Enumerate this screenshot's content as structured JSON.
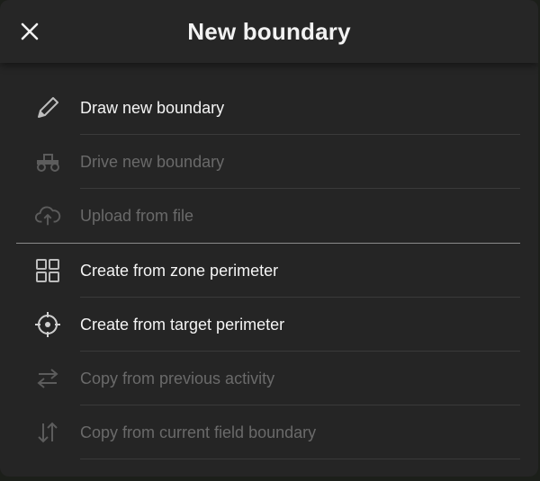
{
  "dialog": {
    "title": "New boundary",
    "close_icon": "close-icon"
  },
  "menu": {
    "group1": [
      {
        "label": "Draw new boundary",
        "icon": "pencil-icon",
        "enabled": true
      },
      {
        "label": "Drive new boundary",
        "icon": "tractor-icon",
        "enabled": false
      },
      {
        "label": "Upload from file",
        "icon": "cloud-upload-icon",
        "enabled": false
      }
    ],
    "group2": [
      {
        "label": "Create from zone perimeter",
        "icon": "grid-icon",
        "enabled": true
      },
      {
        "label": "Create from target perimeter",
        "icon": "crosshair-icon",
        "enabled": true
      },
      {
        "label": "Copy from previous activity",
        "icon": "swap-horizontal-icon",
        "enabled": false
      },
      {
        "label": "Copy from current field boundary",
        "icon": "swap-vertical-icon",
        "enabled": false
      }
    ]
  },
  "colors": {
    "enabled_text": "#f4f4f4",
    "disabled_text": "#6a6a6a",
    "panel_bg": "#252525"
  }
}
